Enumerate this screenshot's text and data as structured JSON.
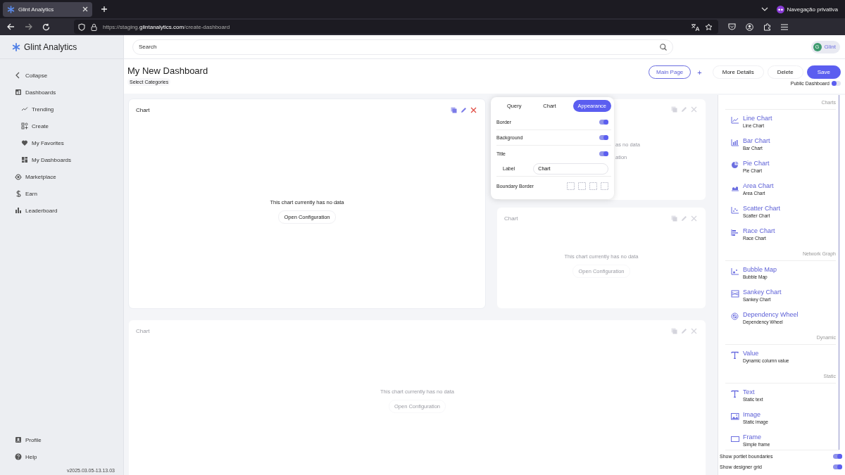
{
  "browser": {
    "tab": {
      "title": "Glint Analytics"
    },
    "private_label": "Navegação privativa",
    "url": "https://staging.**glintanalytics.com**/create-dashboard"
  },
  "sidebar": {
    "logo": "Glint Analytics",
    "items": [
      {
        "label": "Collapse"
      },
      {
        "label": "Dashboards",
        "children": [
          {
            "label": "Trending"
          },
          {
            "label": "Create"
          },
          {
            "label": "My Favorites"
          },
          {
            "label": "My Dashboards"
          }
        ]
      },
      {
        "label": "Marketplace"
      },
      {
        "label": "Earn"
      },
      {
        "label": "Leaderboard"
      }
    ],
    "footer_items": [
      {
        "label": "Profile"
      },
      {
        "label": "Help"
      }
    ],
    "version": "v2025.03.05-13.13.03"
  },
  "topbar": {
    "search": {
      "placeholder": "Search"
    },
    "user": {
      "initial": "G",
      "name": "Glint"
    }
  },
  "header": {
    "title": "My New Dashboard",
    "categories": "Select Categories",
    "buttons": [
      {
        "label": "Main Page",
        "kind": "outline"
      },
      {
        "label": "+",
        "kind": "plus"
      },
      {
        "label": "More Details",
        "kind": "plain"
      },
      {
        "label": "Delete",
        "kind": "plain"
      },
      {
        "label": "Save",
        "kind": "primary"
      }
    ],
    "public_toggle": {
      "label": "Public Dashboard",
      "on": false
    }
  },
  "portlets": [
    {
      "dimmed": false,
      "title": "Chart",
      "message": "This chart currently has no data",
      "action": "Open Configuration"
    },
    {
      "dimmed": true,
      "message": "as no data",
      "action": "ation"
    },
    {
      "dimmed": true,
      "title": "Chart",
      "message": "This chart currently has no data",
      "action": "Open Configuration"
    },
    {
      "dimmed": true,
      "title": "Chart",
      "message": "This chart currently has no data",
      "action": "Open Configuration"
    }
  ],
  "popover": {
    "tabs": [
      {
        "label": "Query",
        "selected": false
      },
      {
        "label": "Chart",
        "selected": false
      },
      {
        "label": "Appearance",
        "selected": true
      }
    ],
    "rows": [
      {
        "kind": "toggle",
        "label": "Border",
        "on": true
      },
      {
        "kind": "toggle",
        "label": "Background",
        "on": true
      },
      {
        "kind": "toggle",
        "label": "Title",
        "on": true
      },
      {
        "kind": "field",
        "label": "Label",
        "value": "Chart"
      },
      {
        "kind": "boundary",
        "label": "Boundary Border"
      }
    ]
  },
  "palette": {
    "sections": [
      {
        "title": "Charts",
        "items": [
          {
            "title": "Line Chart",
            "subtitle": "Line Chart"
          },
          {
            "title": "Bar Chart",
            "subtitle": "Bar Chart"
          },
          {
            "title": "Pie Chart",
            "subtitle": "Pie Chart"
          },
          {
            "title": "Area Chart",
            "subtitle": "Area Chart"
          },
          {
            "title": "Scatter Chart",
            "subtitle": "Scatter Chart"
          },
          {
            "title": "Race Chart",
            "subtitle": "Race Chart"
          }
        ]
      },
      {
        "title": "Network Graph",
        "items": [
          {
            "title": "Bubble Map",
            "subtitle": "Bubble Map"
          },
          {
            "title": "Sankey Chart",
            "subtitle": "Sankey  Chart"
          },
          {
            "title": "Dependency Wheel",
            "subtitle": "Dependency Wheel"
          }
        ]
      },
      {
        "title": "Dynamic",
        "items": [
          {
            "title": "Value",
            "subtitle": "Dynamic column value"
          }
        ]
      },
      {
        "title": "Static",
        "items": [
          {
            "title": "Text",
            "subtitle": "Static text"
          },
          {
            "title": "Image",
            "subtitle": "Static image"
          },
          {
            "title": "Frame",
            "subtitle": "Simple frame"
          }
        ]
      }
    ],
    "settings": [
      {
        "label": "Show portlet boundaries",
        "on": true
      },
      {
        "label": "Show designer grid",
        "on": true
      }
    ]
  }
}
